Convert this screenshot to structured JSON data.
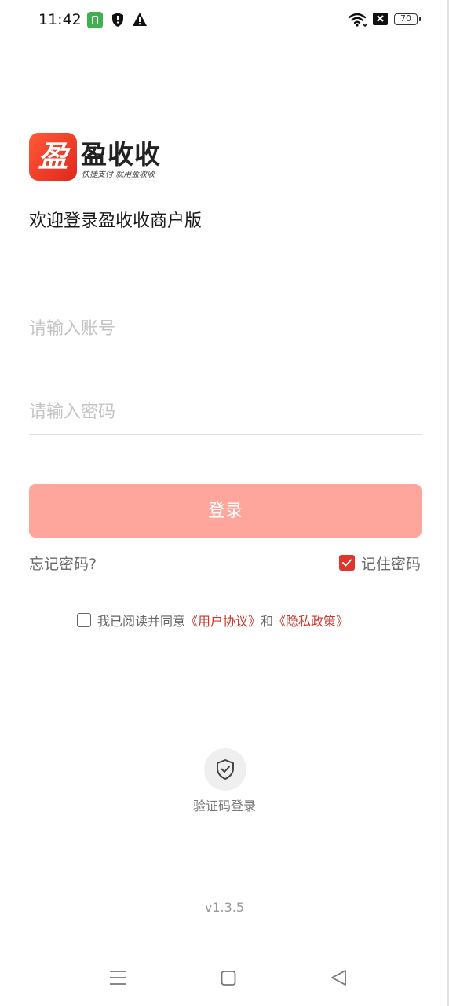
{
  "status_bar": {
    "time": "11:42",
    "battery": "70",
    "icons": [
      "app-icon",
      "shield-icon",
      "warning-icon",
      "wifi-icon",
      "sim-off-icon",
      "battery-icon"
    ]
  },
  "brand": {
    "logo_char": "盈",
    "name": "盈收收",
    "slogan": "快捷支付 就用盈收收",
    "accent_color": "#e0271e"
  },
  "welcome": "欢迎登录盈收收商户版",
  "form": {
    "account_placeholder": "请输入账号",
    "account_value": "",
    "password_placeholder": "请输入密码",
    "password_value": "",
    "login_label": "登录",
    "login_color": "#fea69b",
    "forgot_label": "忘记密码?",
    "remember_label": "记住密码",
    "remember_checked": true
  },
  "agreement": {
    "checked": false,
    "prefix": "我已阅读并同意",
    "user_agreement": "《用户协议》",
    "and": "和",
    "privacy_policy": "《隐私政策》"
  },
  "sms_login": {
    "label": "验证码登录",
    "icon": "shield-check-icon"
  },
  "version": "v1.3.5",
  "nav_bar": [
    "menu-icon",
    "home-icon",
    "back-icon"
  ]
}
